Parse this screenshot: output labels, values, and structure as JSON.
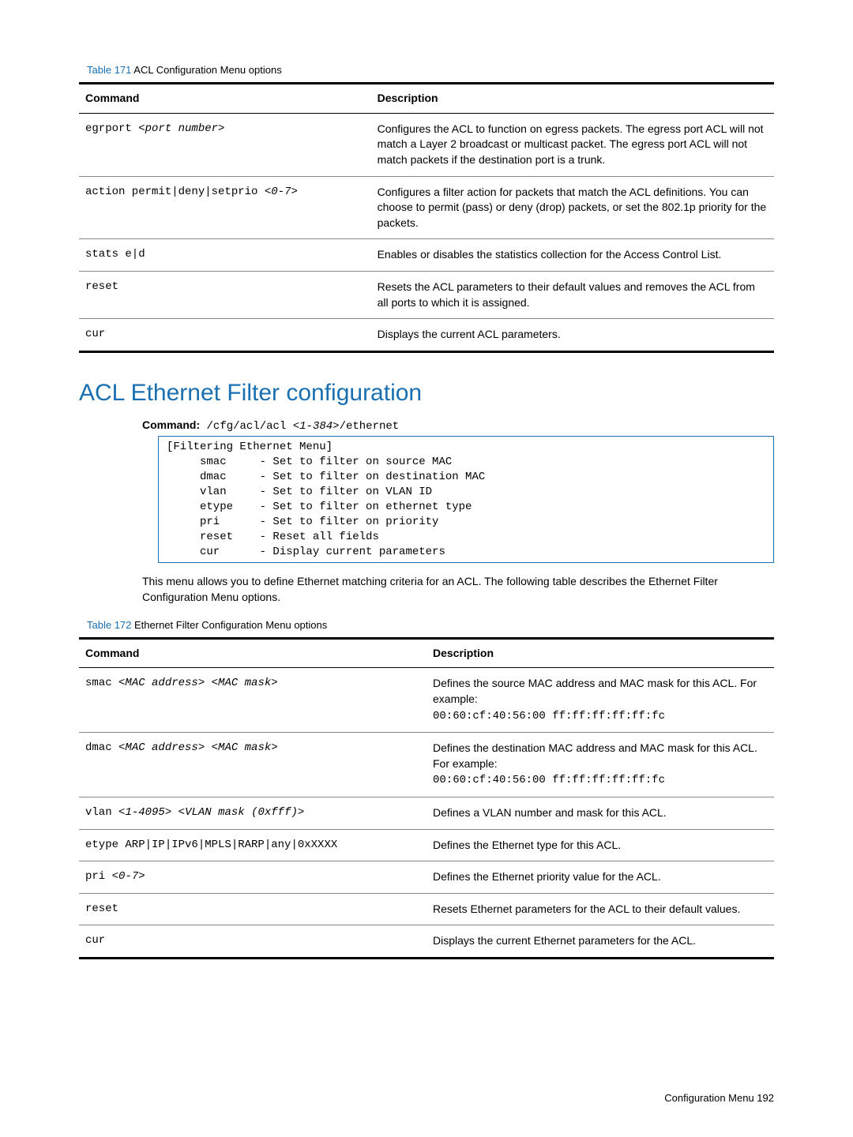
{
  "table171": {
    "caption_num": "Table 171",
    "caption_text": " ACL Configuration Menu options",
    "head_cmd": "Command",
    "head_desc": "Description",
    "rows": [
      {
        "cmd_pre": "egrport ",
        "cmd_arg": "<port number>",
        "desc": "Configures the ACL to function on egress packets. The egress port ACL will not match a Layer 2 broadcast or multicast packet. The egress port ACL will not match packets if the destination port is a trunk."
      },
      {
        "cmd_pre": "action permit|deny|setprio <",
        "cmd_arg": "0-7",
        "cmd_post": ">",
        "desc": "Configures a filter action for packets that match the ACL definitions. You can choose to permit (pass) or deny (drop) packets, or set the 802.1p priority for the packets."
      },
      {
        "cmd_pre": "stats e|d",
        "desc": "Enables or disables the statistics collection for the Access Control List."
      },
      {
        "cmd_pre": "reset",
        "desc": "Resets the ACL parameters to their default values and removes the ACL from all ports to which it is assigned."
      },
      {
        "cmd_pre": "cur",
        "desc": "Displays the current ACL parameters."
      }
    ]
  },
  "section": {
    "heading": "ACL Ethernet Filter configuration",
    "cmdlabel": "Command:",
    "cmdtext_pre": " /cfg/acl/acl <",
    "cmdtext_arg": "1-384",
    "cmdtext_post": ">/ethernet",
    "codebox": "[Filtering Ethernet Menu]\n     smac     - Set to filter on source MAC\n     dmac     - Set to filter on destination MAC\n     vlan     - Set to filter on VLAN ID\n     etype    - Set to filter on ethernet type\n     pri      - Set to filter on priority\n     reset    - Reset all fields\n     cur      - Display current parameters",
    "para": "This menu allows you to define Ethernet matching criteria for an ACL. The following table describes the Ethernet Filter Configuration Menu options."
  },
  "table172": {
    "caption_num": "Table 172",
    "caption_text": " Ethernet Filter Configuration Menu options",
    "head_cmd": "Command",
    "head_desc": "Description",
    "rows": [
      {
        "cmd_pre": "smac ",
        "cmd_arg": "<MAC address> <MAC mask>",
        "desc_pre": "Defines the source MAC address and MAC mask for this ACL. For example:",
        "desc_mono": "00:60:cf:40:56:00 ff:ff:ff:ff:ff:fc"
      },
      {
        "cmd_pre": "dmac ",
        "cmd_arg": "<MAC address> <MAC mask>",
        "desc_pre": "Defines the destination MAC address and MAC mask for this ACL. For example:",
        "desc_mono": "00:60:cf:40:56:00 ff:ff:ff:ff:ff:fc"
      },
      {
        "cmd_pre": "vlan <",
        "cmd_arg": "1-4095",
        "cmd_mid": "> <",
        "cmd_arg2": "VLAN mask (0xfff)",
        "cmd_post": ">",
        "desc_pre": "Defines a VLAN number and mask for this ACL."
      },
      {
        "cmd_pre": "etype ARP|IP|IPv6|MPLS|RARP|any|0xXXXX",
        "desc_pre": "Defines the Ethernet type for this ACL."
      },
      {
        "cmd_pre": "pri <",
        "cmd_arg": "0-7",
        "cmd_post": ">",
        "desc_pre": "Defines the Ethernet priority value for the ACL."
      },
      {
        "cmd_pre": "reset",
        "desc_pre": "Resets Ethernet parameters for the ACL to their default values."
      },
      {
        "cmd_pre": "cur",
        "desc_pre": "Displays the current Ethernet parameters for the ACL."
      }
    ]
  },
  "footer": {
    "text": "Configuration Menu   192"
  }
}
